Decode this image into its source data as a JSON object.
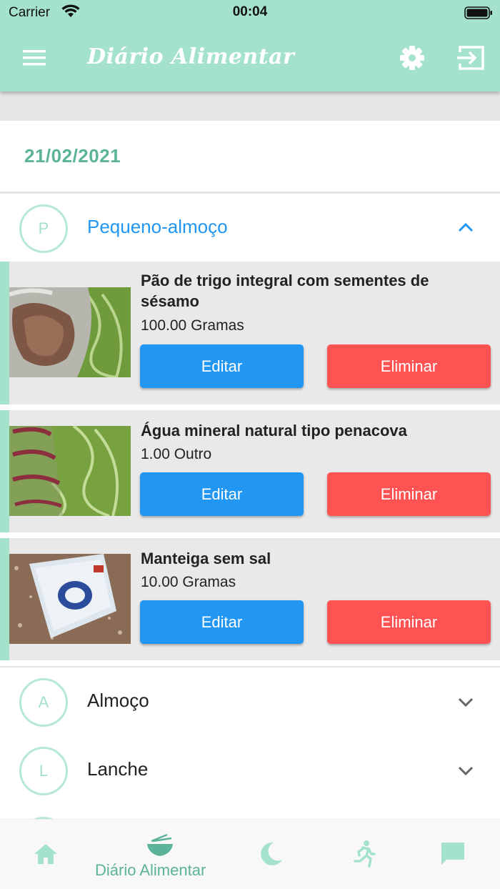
{
  "status_bar": {
    "carrier": "Carrier",
    "time": "00:04"
  },
  "header": {
    "title": "Diário Alimentar",
    "icons": [
      "menu-icon",
      "gear-icon",
      "logout-icon"
    ]
  },
  "date": "21/02/2021",
  "meals": [
    {
      "initial": "P",
      "name": "Pequeno-almoço",
      "expanded": true,
      "items": [
        {
          "name": "Pão de trigo integral com sementes de sésamo",
          "quantity": "100.00 Gramas",
          "edit_label": "Editar",
          "delete_label": "Eliminar"
        },
        {
          "name": "Água mineral natural tipo penacova",
          "quantity": "1.00 Outro",
          "edit_label": "Editar",
          "delete_label": "Eliminar"
        },
        {
          "name": "Manteiga sem sal",
          "quantity": "10.00 Gramas",
          "edit_label": "Editar",
          "delete_label": "Eliminar"
        }
      ]
    },
    {
      "initial": "A",
      "name": "Almoço",
      "expanded": false
    },
    {
      "initial": "L",
      "name": "Lanche",
      "expanded": false
    }
  ],
  "bottom_nav": {
    "active_label": "Diário Alimentar",
    "icons": [
      "home-icon",
      "food-bowl-icon",
      "moon-icon",
      "running-icon",
      "chat-icon"
    ]
  },
  "colors": {
    "accent": "#a5e2cb",
    "date": "#5bb39a",
    "edit": "#2196f3",
    "delete": "#ff5252",
    "active_meal": "#2196f3"
  }
}
